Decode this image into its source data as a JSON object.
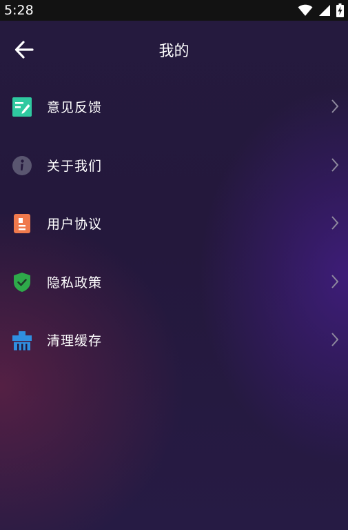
{
  "status_bar": {
    "time": "5:28",
    "icons": [
      "wifi-icon",
      "cell-signal-icon",
      "battery-charging-icon"
    ]
  },
  "app_bar": {
    "title": "我的",
    "back_icon": "arrow-left-icon"
  },
  "menu": {
    "items": [
      {
        "label": "意见反馈",
        "icon": "feedback-edit-icon",
        "color": "#2fc9a0"
      },
      {
        "label": "关于我们",
        "icon": "info-icon",
        "color": "#5a5670"
      },
      {
        "label": "用户协议",
        "icon": "agreement-document-icon",
        "color": "#f07a4d"
      },
      {
        "label": "隐私政策",
        "icon": "privacy-shield-icon",
        "color": "#2eaa4a"
      },
      {
        "label": "清理缓存",
        "icon": "clear-cache-icon",
        "color": "#2f8fe0"
      }
    ],
    "chevron_icon": "chevron-right-icon"
  },
  "colors": {
    "background": "#251a3e",
    "status_bar": "#121212",
    "text": "#ffffff",
    "chevron": "#8f8a9e"
  }
}
